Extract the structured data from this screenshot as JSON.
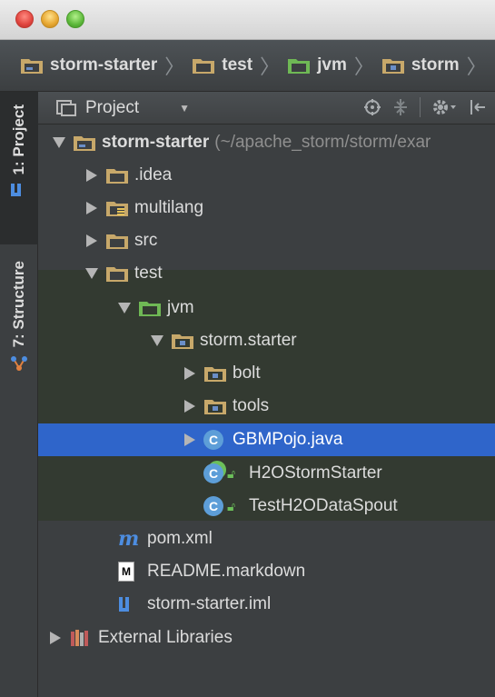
{
  "window": {
    "traffic_lights": [
      "close",
      "minimize",
      "zoom"
    ]
  },
  "navbar": {
    "crumbs": [
      {
        "label": "storm-starter",
        "icon": "module-folder-icon"
      },
      {
        "label": "test",
        "icon": "folder-icon"
      },
      {
        "label": "jvm",
        "icon": "test-source-folder-icon"
      },
      {
        "label": "storm",
        "icon": "package-icon"
      }
    ]
  },
  "toolwindows": {
    "project_tab": "1: Project",
    "structure_tab": "7: Structure"
  },
  "project_panel": {
    "title": "Project"
  },
  "tree": {
    "root": {
      "label": "storm-starter",
      "path": "(~/apache_storm/storm/exar"
    },
    "idea": ".idea",
    "multilang": "multilang",
    "src": "src",
    "test": "test",
    "jvm": "jvm",
    "storm_starter_pkg": "storm.starter",
    "bolt": "bolt",
    "tools": "tools",
    "gbmpojo": "GBMPojo.java",
    "h2ostormstarter": "H2OStormStarter",
    "testh2odataspout": "TestH2ODataSpout",
    "pom": "pom.xml",
    "readme": "README.markdown",
    "iml": "storm-starter.iml",
    "extlibs": "External Libraries"
  },
  "colors": {
    "folder": "#c7a86a",
    "test_folder": "#6fb855",
    "selection": "#2f65ca",
    "test_band": "#333a31",
    "class_badge": "#5d9ed8"
  }
}
